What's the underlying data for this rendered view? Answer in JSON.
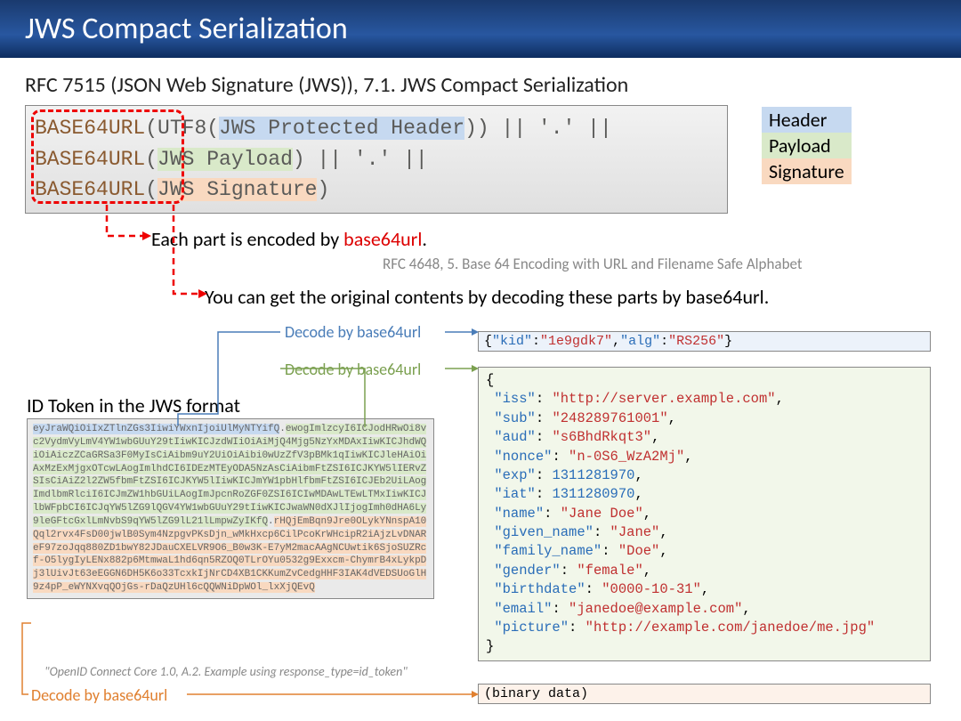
{
  "title": "JWS Compact Serialization",
  "rfc_heading": "RFC 7515 (JSON Web Signature (JWS)), 7.1. JWS Compact Serialization",
  "code": {
    "b64": "BASE64URL",
    "l1a": "(UTF8(",
    "l1b": "JWS Protected Header",
    "l1c": "))",
    "l1d": " || '.' ||",
    "l2a": "(",
    "l2b": "JWS Payload",
    "l2c": ")",
    "l2d": " || '.' ||",
    "l3a": "(",
    "l3b": "JWS Signature",
    "l3c": ")"
  },
  "legend": {
    "header": "Header",
    "payload": "Payload",
    "signature": "Signature"
  },
  "annot1_a": "Each part is encoded by ",
  "annot1_b": "base64url",
  "annot1_c": ".",
  "rfc_note": "RFC 4648, 5. Base 64 Encoding with URL and Filename Safe Alphabet",
  "annot2": "You can get the original contents by decoding these parts by base64url.",
  "decode_label1": "Decode by base64url",
  "decode_label2": "Decode by base64url",
  "decode_label3": "Decode by base64url",
  "token_heading": "ID Token in the JWS format",
  "token": {
    "header": "eyJraWQiOiIxZTlnZGs3IiwiYWxnIjoiUlMyNTYifQ",
    "dot1": ".",
    "payload": "ewogImlzcyI6ICJodHRwOi8vc2VydmVyLmV4YW1wbGUuY29tIiwKICJzdWIiOiAiMjQ4Mjg5NzYxMDAxIiwKICJhdWQiOiAiczZCaGRSa3F0MyIsCiAibm9uY2UiOiAibi0wUzZfV3pBMk1qIiwKICJleHAiOiAxMzExMjgxOTcwLAogImlhdCI6IDEzMTEyODA5NzAsCiAibmFtZSI6ICJKYW5lIERvZSIsCiAiZ2l2ZW5fbmFtZSI6ICJKYW5lIiwKICJmYW1pbHlfbmFtZSI6ICJEb2UiLAogImdlbmRlciI6ICJmZW1hbGUiLAogImJpcnRoZGF0ZSI6ICIwMDAwLTEwLTMxIiwKICJlbWFpbCI6ICJqYW5lZG9lQGV4YW1wbGUuY29tIiwKICJwaWN0dXJlIjogImh0dHA6Ly9leGFtcGxlLmNvbS9qYW5lZG9lL21lLmpwZyIKfQ",
    "dot2": ".",
    "signature": "rHQjEmBqn9Jre0OLykYNnspA10Qql2rvx4FsD00jwlB0Sym4NzpgvPKsDjn_wMkHxcp6CilPcoKrWHcipR2iAjzLvDNAReF97zoJqq880ZD1bwY82JDauCXELVR9O6_B0w3K-E7yM2macAAgNCUwtik6SjoSUZRcf-O5lygIyLENx882p6MtmwaL1hd6qn5RZOQ0TLrOYu0532g9Exxcm-ChymrB4xLykpDj3lUivJt63eEGGN6DH5K6o33TcxkIjNrCD4XB1CKKumZvCedgHHF3IAK4dVEDSUoGlH9z4pP_eWYNXvqQOjGs-rDaQzUHl6cQQWNiDpWOl_lxXjQEvQ"
  },
  "token_cite": "\"OpenID Connect Core 1.0, A.2. Example using response_type=id_token\"",
  "decoded_header": {
    "kid_k": "\"kid\"",
    "kid_v": "\"1e9gdk7\"",
    "alg_k": "\"alg\"",
    "alg_v": "\"RS256\""
  },
  "decoded_payload": {
    "iss_k": "\"iss\"",
    "iss_v": "\"http://server.example.com\"",
    "sub_k": "\"sub\"",
    "sub_v": "\"248289761001\"",
    "aud_k": "\"aud\"",
    "aud_v": "\"s6BhdRkqt3\"",
    "nonce_k": "\"nonce\"",
    "nonce_v": "\"n-0S6_WzA2Mj\"",
    "exp_k": "\"exp\"",
    "exp_v": "1311281970",
    "iat_k": "\"iat\"",
    "iat_v": "1311280970",
    "name_k": "\"name\"",
    "name_v": "\"Jane Doe\"",
    "given_k": "\"given_name\"",
    "given_v": "\"Jane\"",
    "family_k": "\"family_name\"",
    "family_v": "\"Doe\"",
    "gender_k": "\"gender\"",
    "gender_v": "\"female\"",
    "birth_k": "\"birthdate\"",
    "birth_v": "\"0000-10-31\"",
    "email_k": "\"email\"",
    "email_v": "\"janedoe@example.com\"",
    "pic_k": "\"picture\"",
    "pic_v": "\"http://example.com/janedoe/me.jpg\""
  },
  "decoded_sig": "(binary data)"
}
